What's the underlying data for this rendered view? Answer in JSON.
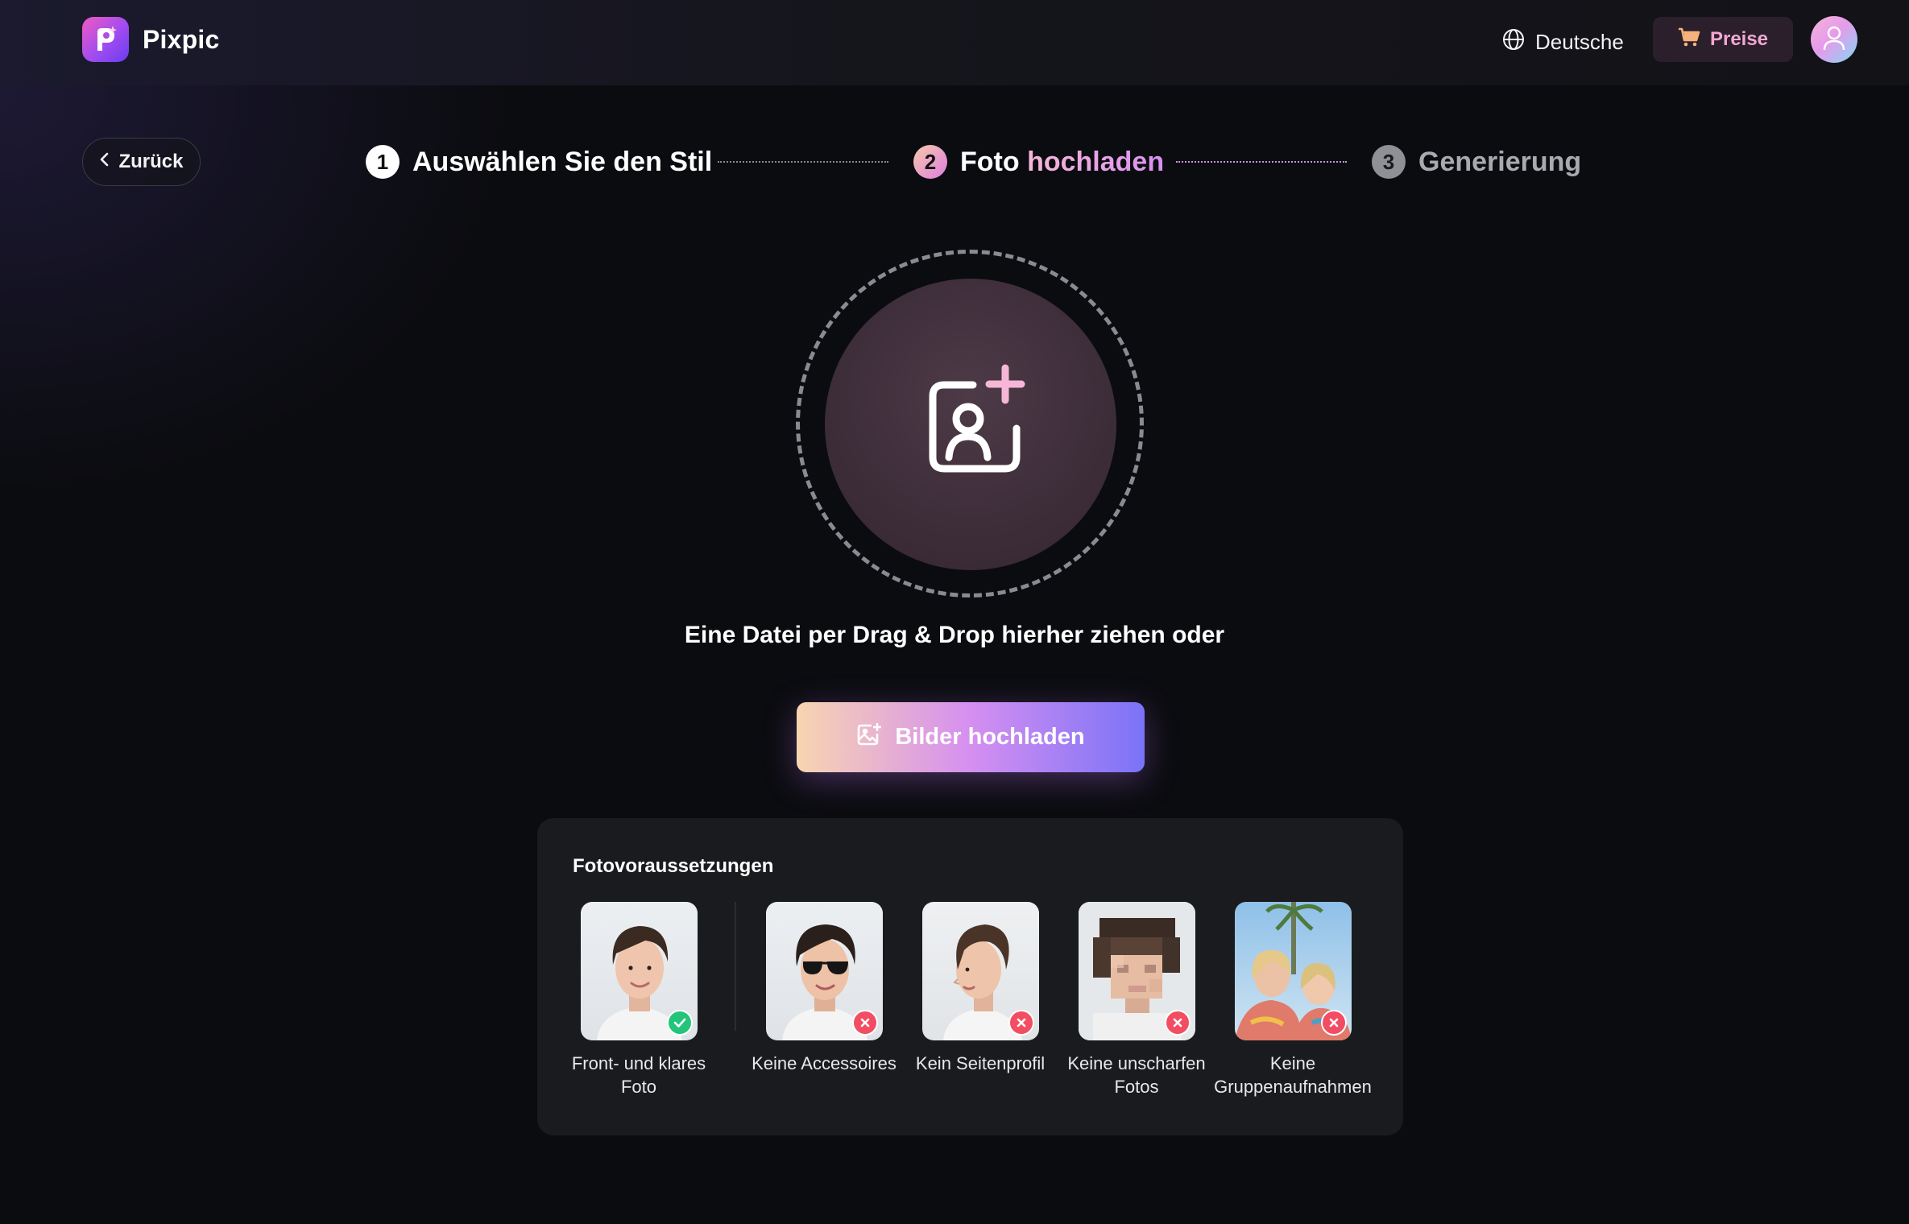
{
  "header": {
    "app_name": "Pixpic",
    "language_label": "Deutsche",
    "pricing_label": "Preise"
  },
  "nav": {
    "back_label": "Zurück"
  },
  "stepper": {
    "steps": [
      {
        "number": "1",
        "label": "Auswählen Sie den Stil",
        "state": "done"
      },
      {
        "number": "2",
        "label_plain": "Foto",
        "label_highlight": "hochladen",
        "state": "active"
      },
      {
        "number": "3",
        "label": "Generierung",
        "state": "pending"
      }
    ]
  },
  "upload": {
    "drop_text": "Eine Datei per Drag & Drop hierher ziehen oder",
    "button_label": "Bilder hochladen"
  },
  "requirements": {
    "title": "Fotovoraussetzungen",
    "items": [
      {
        "label": "Front- und klares Foto",
        "status": "ok",
        "image": "clear-front-portrait"
      },
      {
        "label": "Keine Accessoires",
        "status": "no",
        "image": "portrait-with-sunglasses"
      },
      {
        "label": "Kein Seitenprofil",
        "status": "no",
        "image": "side-profile-portrait"
      },
      {
        "label": "Keine unscharfen Fotos",
        "status": "no",
        "image": "pixelated-portrait"
      },
      {
        "label": "Keine Gruppenaufnahmen",
        "status": "no",
        "image": "group-photo"
      }
    ]
  },
  "colors": {
    "background": "#0b0c10",
    "accent_pink": "#f4a7d3",
    "success": "#22c57a",
    "error": "#f24d62"
  }
}
